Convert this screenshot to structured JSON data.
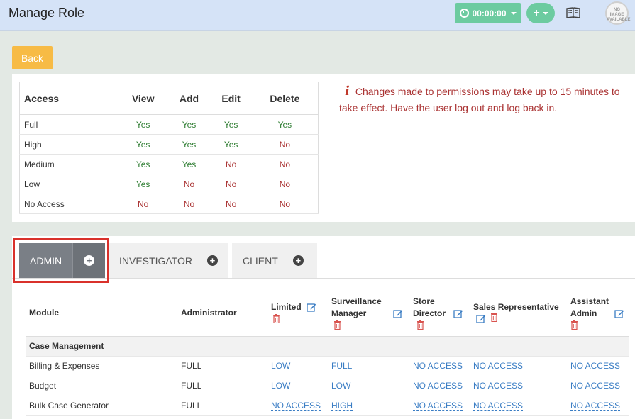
{
  "header": {
    "title": "Manage Role",
    "timer_label": "00:00:00",
    "add_label": "+",
    "avatar_text": "NO IMAGE AVAILABLE"
  },
  "back_label": "Back",
  "access_table": {
    "headers": [
      "Access",
      "View",
      "Add",
      "Edit",
      "Delete"
    ],
    "rows": [
      {
        "level": "Full",
        "view": "Yes",
        "add": "Yes",
        "edit": "Yes",
        "delete": "Yes"
      },
      {
        "level": "High",
        "view": "Yes",
        "add": "Yes",
        "edit": "Yes",
        "delete": "No"
      },
      {
        "level": "Medium",
        "view": "Yes",
        "add": "Yes",
        "edit": "No",
        "delete": "No"
      },
      {
        "level": "Low",
        "view": "Yes",
        "add": "No",
        "edit": "No",
        "delete": "No"
      },
      {
        "level": "No Access",
        "view": "No",
        "add": "No",
        "edit": "No",
        "delete": "No"
      }
    ]
  },
  "notice": {
    "icon": "i",
    "text": "Changes made to permissions may take up to 15 minutes to take effect. Have the user log out and log back in."
  },
  "tabs": [
    {
      "label": "ADMIN",
      "active": true
    },
    {
      "label": "INVESTIGATOR",
      "active": false
    },
    {
      "label": "CLIENT",
      "active": false
    }
  ],
  "permissions": {
    "headers": {
      "module": "Module",
      "administrator": "Administrator",
      "limited": "Limited",
      "surveillance_manager": "Surveillance Manager",
      "store_director": "Store Director",
      "sales_rep": "Sales Representative",
      "assistant_admin": "Assistant Admin"
    },
    "section": "Case Management",
    "rows": [
      {
        "module": "Billing & Expenses",
        "administrator": "FULL",
        "limited": "LOW",
        "surveillance_manager": "FULL",
        "store_director": "NO ACCESS",
        "sales_rep": "NO ACCESS",
        "assistant_admin": "NO ACCESS"
      },
      {
        "module": "Budget",
        "administrator": "FULL",
        "limited": "LOW",
        "surveillance_manager": "LOW",
        "store_director": "NO ACCESS",
        "sales_rep": "NO ACCESS",
        "assistant_admin": "NO ACCESS"
      },
      {
        "module": "Bulk Case Generator",
        "administrator": "FULL",
        "limited": "NO ACCESS",
        "surveillance_manager": "HIGH",
        "store_director": "NO ACCESS",
        "sales_rep": "NO ACCESS",
        "assistant_admin": "NO ACCESS"
      }
    ]
  },
  "colors": {
    "header_bg": "#d5e3f7",
    "accent_green": "#6ccba0",
    "back_orange": "#f7bb45",
    "notice_red": "#a33",
    "link_blue": "#3a7dc4"
  }
}
